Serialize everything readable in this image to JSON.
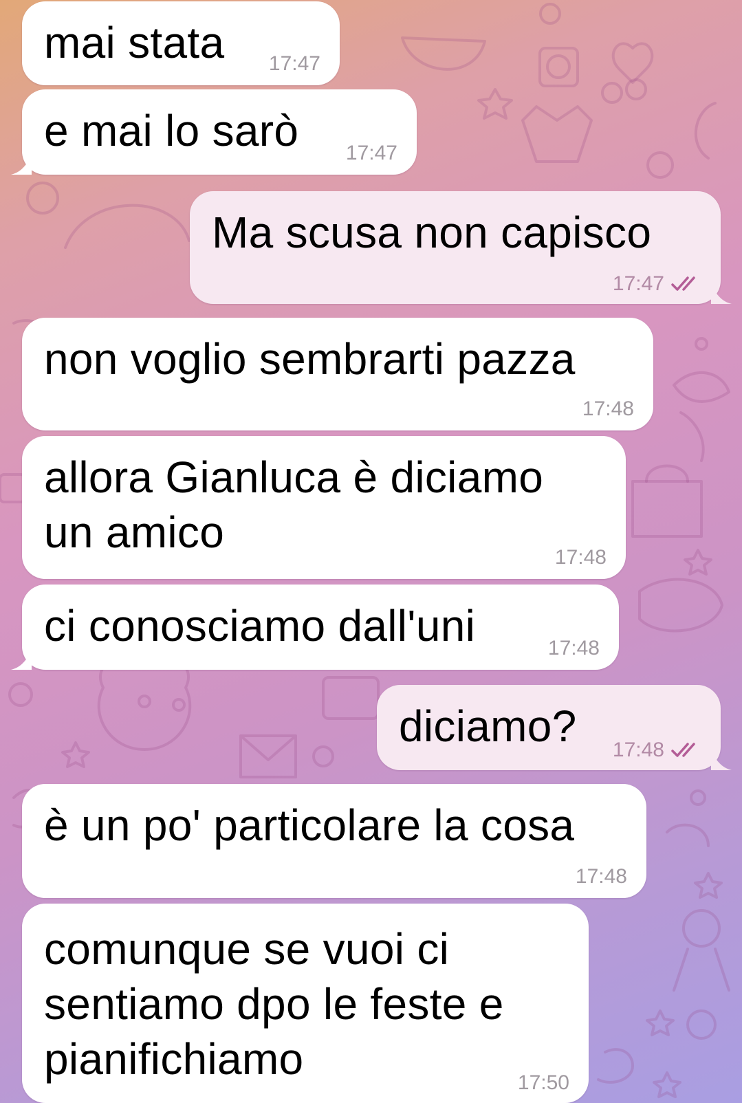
{
  "chat": {
    "messages": [
      {
        "dir": "in",
        "text": "mai stata",
        "time": "17:47"
      },
      {
        "dir": "in",
        "text": "e mai lo sarò",
        "time": "17:47"
      },
      {
        "dir": "out",
        "text": "Ma scusa non capisco",
        "time": "17:47",
        "status": "read"
      },
      {
        "dir": "in",
        "text": "non voglio sembrarti pazza",
        "time": "17:48"
      },
      {
        "dir": "in",
        "text": "allora Gianluca è diciamo\nun amico",
        "time": "17:48"
      },
      {
        "dir": "in",
        "text": "ci conosciamo dall'uni",
        "time": "17:48"
      },
      {
        "dir": "out",
        "text": "diciamo?",
        "time": "17:48",
        "status": "read"
      },
      {
        "dir": "in",
        "text": "è un po' particolare la cosa",
        "time": "17:48"
      },
      {
        "dir": "in",
        "text": "comunque se vuoi ci\nsentiamo dpo le feste e\npianifichiamo",
        "time": "17:50"
      }
    ]
  },
  "colors": {
    "incoming_bubble": "#ffffff",
    "outgoing_bubble": "#f7e8f1",
    "timestamp_in": "#a09aa0",
    "timestamp_out": "#b28aa5",
    "read_ticks": "#b35c96"
  },
  "icons": {
    "read_status": "double-check-icon",
    "wallpaper": "doodle-pattern"
  }
}
